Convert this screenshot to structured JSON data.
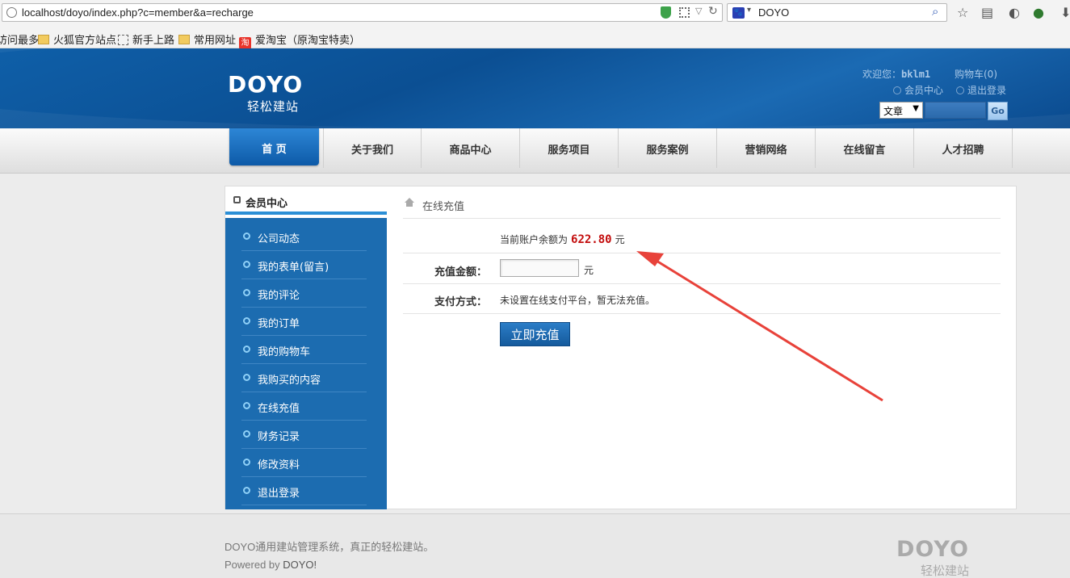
{
  "browser": {
    "url": "localhost/doyo/index.php?c=member&a=recharge",
    "search_engine_text": "DOYO",
    "bookmarks": [
      "访问最多",
      "火狐官方站点",
      "新手上路",
      "常用网址",
      "爱淘宝（原淘宝特卖）"
    ],
    "taobao_glyph": "淘"
  },
  "header": {
    "logo": "DOYO",
    "logo_sub": "轻松建站",
    "welcome_label": "欢迎您：",
    "username": "bklm1",
    "cart": "购物车(0)",
    "member_center_link": "会员中心",
    "logout_link": "退出登录",
    "search_select": "文章",
    "search_go": "Go"
  },
  "nav": [
    "首 页",
    "关于我们",
    "商品中心",
    "服务项目",
    "服务案例",
    "营销网络",
    "在线留言",
    "人才招聘"
  ],
  "sidebar": {
    "title": "会员中心",
    "items": [
      "公司动态",
      "我的表单(留言)",
      "我的评论",
      "我的订单",
      "我的购物车",
      "我购买的内容",
      "在线充值",
      "财务记录",
      "修改资料",
      "退出登录"
    ]
  },
  "main": {
    "breadcrumb": "在线充值",
    "balance_label": "当前账户余额为",
    "balance": "622.80",
    "balance_unit": "元",
    "amount_label": "充值金额：",
    "amount_value": "",
    "amount_unit": "元",
    "pay_label": "支付方式：",
    "pay_text": "未设置在线支付平台，暂无法充值。",
    "submit": "立即充值"
  },
  "footer": {
    "line1": "DOYO通用建站管理系统，真正的轻松建站。",
    "powered_prefix": "Powered by ",
    "powered_brand": "DOYO!",
    "logo": "DOYO",
    "logo_sub": "轻松建站"
  },
  "colors": {
    "annotation_arrow": "#e8423a",
    "brand_blue": "#0b4f93",
    "balance_red": "#c30d0d"
  }
}
